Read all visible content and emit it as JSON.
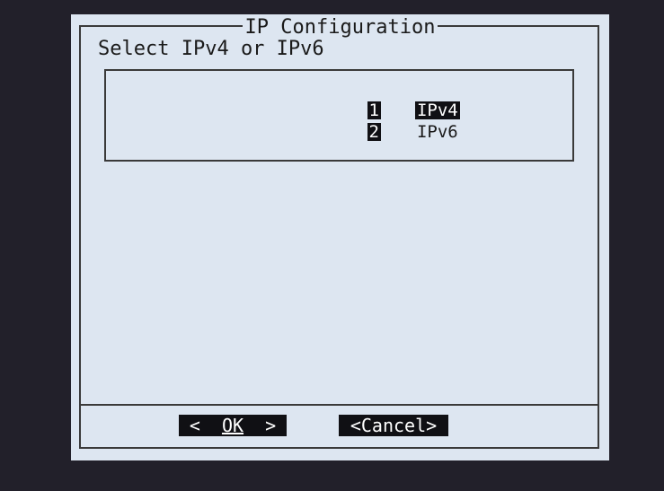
{
  "dialog": {
    "title": "IP Configuration",
    "prompt": "Select IPv4 or IPv6",
    "menu": [
      {
        "tag": "1",
        "label": "IPv4",
        "selected": true
      },
      {
        "tag": "2",
        "label": "IPv6",
        "selected": false
      }
    ],
    "buttons": {
      "ok_left": "<  ",
      "ok_label": "OK",
      "ok_right": "  >",
      "cancel_label": "<Cancel>"
    }
  },
  "colors": {
    "background": "#22202a",
    "dialog": "#dde6f1",
    "highlight": "#101014",
    "border": "#3a3a3a"
  }
}
